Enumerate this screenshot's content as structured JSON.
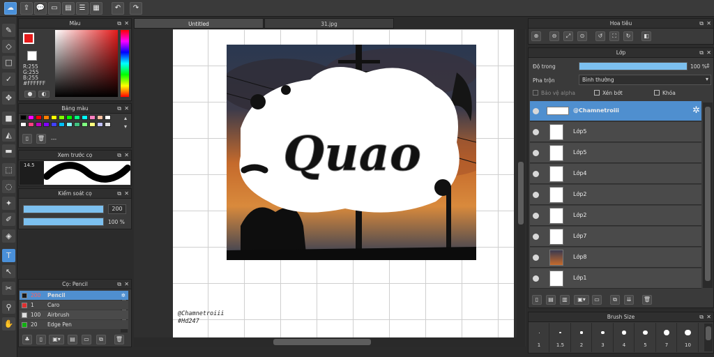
{
  "tabs": {
    "untitled": "Untitled",
    "file": "31.jpg"
  },
  "panels": {
    "color": "Màu",
    "palette": "Bảng màu",
    "brush_preview": "Xem trước cọ",
    "brush_control": "Kiểm soát cọ",
    "brush": "Cọ: Pencil",
    "navigator": "Hoa tiêu",
    "layers": "Lớp",
    "brush_size": "Brush Size"
  },
  "color": {
    "r": "R:255",
    "g": "G:255",
    "b": "B:255",
    "hex": "#FFFFFF",
    "primary": "#e51b1b",
    "secondary": "#ffffff"
  },
  "palette": {
    "colors": [
      "#000000",
      "#ff00ff",
      "#ff0000",
      "#ff8000",
      "#ffff00",
      "#80ff00",
      "#00ff00",
      "#00ff80",
      "#00ffff",
      "#ff80c0",
      "#ffc0a0",
      "#ffffff",
      "#ffffff",
      "#ff4080",
      "#c000c0",
      "#8000ff",
      "#4040ff",
      "#00c0ff",
      "#80ffff",
      "#40c080",
      "#80ff80",
      "#ffff80",
      "#c0c0ff",
      "#e0e0e0"
    ],
    "extra_label": "---"
  },
  "brush_preview": {
    "size": "14.5"
  },
  "brush_control": {
    "size_value": "200",
    "opacity_value": "100 %",
    "size_fill": 1.0,
    "opacity_fill": 1.0
  },
  "brushes": [
    {
      "size": "200",
      "name": "Pencil",
      "color": "#1a1a1a",
      "selected": true
    },
    {
      "size": "1",
      "name": "Caro",
      "color": "#e03030",
      "selected": false
    },
    {
      "size": "100",
      "name": "Airbrush",
      "color": "#e0e0e0",
      "selected": false
    },
    {
      "size": "20",
      "name": "Edge Pen",
      "color": "#10b010",
      "selected": false
    }
  ],
  "layers_panel": {
    "opacity_label": "Độ trong",
    "opacity_value": "100 %",
    "opacity_fill": 1.0,
    "blend_label": "Pha trộn",
    "blend_value": "Bình thường",
    "protect_alpha": "Bảo vệ alpha",
    "clipping": "Xén bớt",
    "lock": "Khóa",
    "items": [
      {
        "name": "@Chamnetroiii",
        "selected": true
      },
      {
        "name": "Lớp5",
        "selected": false
      },
      {
        "name": "Lớp5",
        "selected": false
      },
      {
        "name": "Lớp4",
        "selected": false
      },
      {
        "name": "Lớp2",
        "selected": false
      },
      {
        "name": "Lớp2",
        "selected": false
      },
      {
        "name": "Lớp7",
        "selected": false
      },
      {
        "name": "Lớp8",
        "selected": false
      },
      {
        "name": "Lớp1",
        "selected": false
      }
    ]
  },
  "brush_sizes": [
    "1",
    "1.5",
    "2",
    "3",
    "4",
    "5",
    "7",
    "10"
  ],
  "canvas": {
    "artwork_text": "Quao",
    "watermark_line1": "@Chamnetroiii",
    "watermark_line2": "#Hd247"
  },
  "accent": "#4a90d9"
}
